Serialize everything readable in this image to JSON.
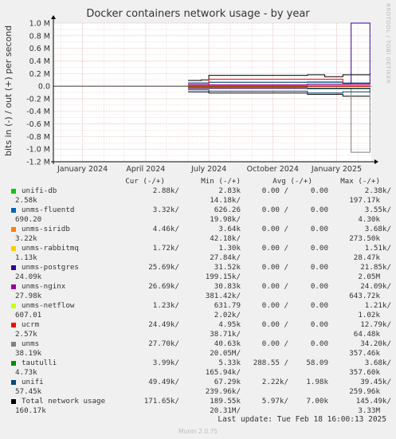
{
  "title": "Docker containers network usage - by year",
  "watermark": "RRDTOOL / TOBI OETIKER",
  "munin_version": "Munin 2.0.75",
  "last_update": "Last update:  Tue Feb 18 16:00:13 2025",
  "colors": {
    "unifi-db": "#00cc00",
    "unms-fluentd": "#0066b3",
    "unms-siridb": "#ff8000",
    "unms-rabbitmq": "#ffcc00",
    "unms-postgres": "#330099",
    "unms-nginx": "#990099",
    "unms-netflow": "#ccff00",
    "ucrm": "#ff0000",
    "unms": "#808080",
    "tautulli": "#008f00",
    "unifi": "#00487d",
    "Total network usage": "#000000"
  },
  "legend_header": {
    "cur": "Cur (-/+)",
    "min": "Min (-/+)",
    "avg": "Avg (-/+)",
    "max": "Max (-/+)"
  },
  "legend": [
    {
      "name": "unifi-db",
      "cur_out": "2.88k/",
      "min_out": "2.83k",
      "avg_out": "0.00 /",
      "avg_in": "0.00",
      "max_out": "2.38k/",
      "cur_in": "2.58k",
      "min_in": "14.18k/",
      "max_in": "197.17k"
    },
    {
      "name": "unms-fluentd",
      "cur_out": "3.32k/",
      "min_out": "626.26",
      "avg_out": "0.00 /",
      "avg_in": "0.00",
      "max_out": "3.55k/",
      "cur_in": "690.20",
      "min_in": "19.98k/",
      "max_in": "4.30k"
    },
    {
      "name": "unms-siridb",
      "cur_out": "4.46k/",
      "min_out": "3.64k",
      "avg_out": "0.00 /",
      "avg_in": "0.00",
      "max_out": "3.68k/",
      "cur_in": "3.22k",
      "min_in": "42.18k/",
      "max_in": "273.50k"
    },
    {
      "name": "unms-rabbitmq",
      "cur_out": "1.72k/",
      "min_out": "1.30k",
      "avg_out": "0.00 /",
      "avg_in": "0.00",
      "max_out": "1.51k/",
      "cur_in": "1.13k",
      "min_in": "27.84k/",
      "max_in": "28.47k"
    },
    {
      "name": "unms-postgres",
      "cur_out": "25.69k/",
      "min_out": "31.52k",
      "avg_out": "0.00 /",
      "avg_in": "0.00",
      "max_out": "21.85k/",
      "cur_in": "24.09k",
      "min_in": "199.15k/",
      "max_in": "2.05M"
    },
    {
      "name": "unms-nginx",
      "cur_out": "26.69k/",
      "min_out": "30.83k",
      "avg_out": "0.00 /",
      "avg_in": "0.00",
      "max_out": "24.09k/",
      "cur_in": "27.98k",
      "min_in": "381.42k/",
      "max_in": "643.72k"
    },
    {
      "name": "unms-netflow",
      "cur_out": "1.23k/",
      "min_out": "631.79",
      "avg_out": "0.00 /",
      "avg_in": "0.00",
      "max_out": "1.21k/",
      "cur_in": "607.01",
      "min_in": "2.02k/",
      "max_in": "1.02k"
    },
    {
      "name": "ucrm",
      "cur_out": "24.49k/",
      "min_out": "4.95k",
      "avg_out": "0.00 /",
      "avg_in": "0.00",
      "max_out": "12.79k/",
      "cur_in": "2.57k",
      "min_in": "38.71k/",
      "max_in": "64.48k"
    },
    {
      "name": "unms",
      "cur_out": "27.70k/",
      "min_out": "40.63k",
      "avg_out": "0.00 /",
      "avg_in": "0.00",
      "max_out": "34.20k/",
      "cur_in": "38.19k",
      "min_in": "20.05M/",
      "max_in": "357.46k"
    },
    {
      "name": "tautulli",
      "cur_out": "3.99k/",
      "min_out": "5.33k",
      "avg_out": "288.55 /",
      "avg_in": "58.09",
      "max_out": "3.68k/",
      "cur_in": "4.73k",
      "min_in": "165.94k/",
      "max_in": "357.60k"
    },
    {
      "name": "unifi",
      "cur_out": "49.49k/",
      "min_out": "67.29k",
      "avg_out": "2.22k/",
      "avg_in": "1.98k",
      "max_out": "39.45k/",
      "cur_in": "57.45k",
      "min_in": "239.96k/",
      "max_in": "259.96k"
    },
    {
      "name": "Total network usage",
      "cur_out": "171.65k/",
      "min_out": "189.55k",
      "avg_out": "5.97k/",
      "avg_in": "7.00k",
      "max_out": "145.49k/",
      "cur_in": "160.17k",
      "min_in": "20.31M/",
      "max_in": "3.33M"
    }
  ],
  "chart_data": {
    "type": "line",
    "title": "Docker containers network usage - by year",
    "ylabel": "bits in (-) / out (+) per second",
    "ylim": [
      -1200000,
      1000000
    ],
    "y_ticks": [
      1000000,
      800000,
      600000,
      400000,
      200000,
      0,
      -200000,
      -400000,
      -600000,
      -800000,
      -1000000,
      -1200000
    ],
    "y_tick_labels": [
      "1.0 M",
      "0.8 M",
      "0.6 M",
      "0.4 M",
      "0.2 M",
      "0.0",
      "-0.2 M",
      "-0.4 M",
      "-0.6 M",
      "-0.8 M",
      "-1.0 M",
      "-1.2 M"
    ],
    "x_range": [
      "2023-11-20",
      "2025-02-20"
    ],
    "x_ticks": [
      "2024-01-01",
      "2024-04-01",
      "2024-07-01",
      "2024-10-01",
      "2025-01-01"
    ],
    "x_tick_labels": [
      "January 2024",
      "April 2024",
      "July 2024",
      "October 2024",
      "January 2025"
    ],
    "grid": true,
    "series": [
      {
        "name": "Total network usage",
        "out": [
          [
            "2024-06-01",
            90000
          ],
          [
            "2024-06-20",
            100000
          ],
          [
            "2024-07-01",
            170000
          ],
          [
            "2024-11-20",
            180000
          ],
          [
            "2024-12-15",
            150000
          ],
          [
            "2025-01-10",
            180000
          ],
          [
            "2025-02-18",
            190000
          ]
        ],
        "in": [
          [
            "2024-06-01",
            -90000
          ],
          [
            "2024-07-01",
            -110000
          ],
          [
            "2024-11-20",
            -130000
          ],
          [
            "2025-01-10",
            -160000
          ],
          [
            "2025-02-18",
            -160000
          ]
        ]
      },
      {
        "name": "unms",
        "out": [
          [
            "2024-06-01",
            40000
          ],
          [
            "2024-07-01",
            60000
          ],
          [
            "2024-11-20",
            70000
          ],
          [
            "2025-01-10",
            40000
          ],
          [
            "2025-02-18",
            30000
          ]
        ],
        "in": [
          [
            "2024-06-01",
            -40000
          ],
          [
            "2025-01-22",
            -1050000
          ],
          [
            "2025-02-18",
            -40000
          ]
        ]
      },
      {
        "name": "unifi",
        "out": [
          [
            "2024-06-01",
            50000
          ],
          [
            "2024-07-01",
            60000
          ],
          [
            "2024-11-20",
            60000
          ],
          [
            "2025-01-10",
            50000
          ],
          [
            "2025-02-18",
            50000
          ]
        ],
        "in": [
          [
            "2024-06-01",
            -60000
          ],
          [
            "2024-07-01",
            -80000
          ],
          [
            "2024-11-20",
            -110000
          ],
          [
            "2025-01-10",
            -90000
          ],
          [
            "2025-02-18",
            -60000
          ]
        ]
      },
      {
        "name": "unms-postgres",
        "out": [
          [
            "2024-06-01",
            20000
          ],
          [
            "2024-11-20",
            30000
          ],
          [
            "2025-01-22",
            1000000
          ],
          [
            "2025-02-18",
            25000
          ]
        ],
        "in": [
          [
            "2024-06-01",
            -30000
          ],
          [
            "2024-11-20",
            -40000
          ],
          [
            "2025-02-18",
            -25000
          ]
        ]
      },
      {
        "name": "ucrm",
        "out": [
          [
            "2024-06-01",
            20000
          ],
          [
            "2024-07-01",
            110000
          ],
          [
            "2024-11-20",
            110000
          ],
          [
            "2025-01-10",
            30000
          ],
          [
            "2025-02-18",
            30000
          ]
        ],
        "in": [
          [
            "2024-06-01",
            -5000
          ],
          [
            "2025-02-18",
            -5000
          ]
        ]
      },
      {
        "name": "unms-nginx",
        "out": [
          [
            "2024-06-01",
            20000
          ],
          [
            "2024-11-20",
            30000
          ],
          [
            "2025-02-18",
            30000
          ]
        ],
        "in": [
          [
            "2024-06-01",
            -30000
          ],
          [
            "2025-02-18",
            -30000
          ]
        ]
      },
      {
        "name": "tautulli",
        "out": [
          [
            "2024-06-01",
            5000
          ],
          [
            "2025-02-18",
            5000
          ]
        ],
        "in": [
          [
            "2024-06-01",
            -20000
          ],
          [
            "2024-11-20",
            -30000
          ],
          [
            "2025-02-18",
            -20000
          ]
        ]
      }
    ]
  }
}
